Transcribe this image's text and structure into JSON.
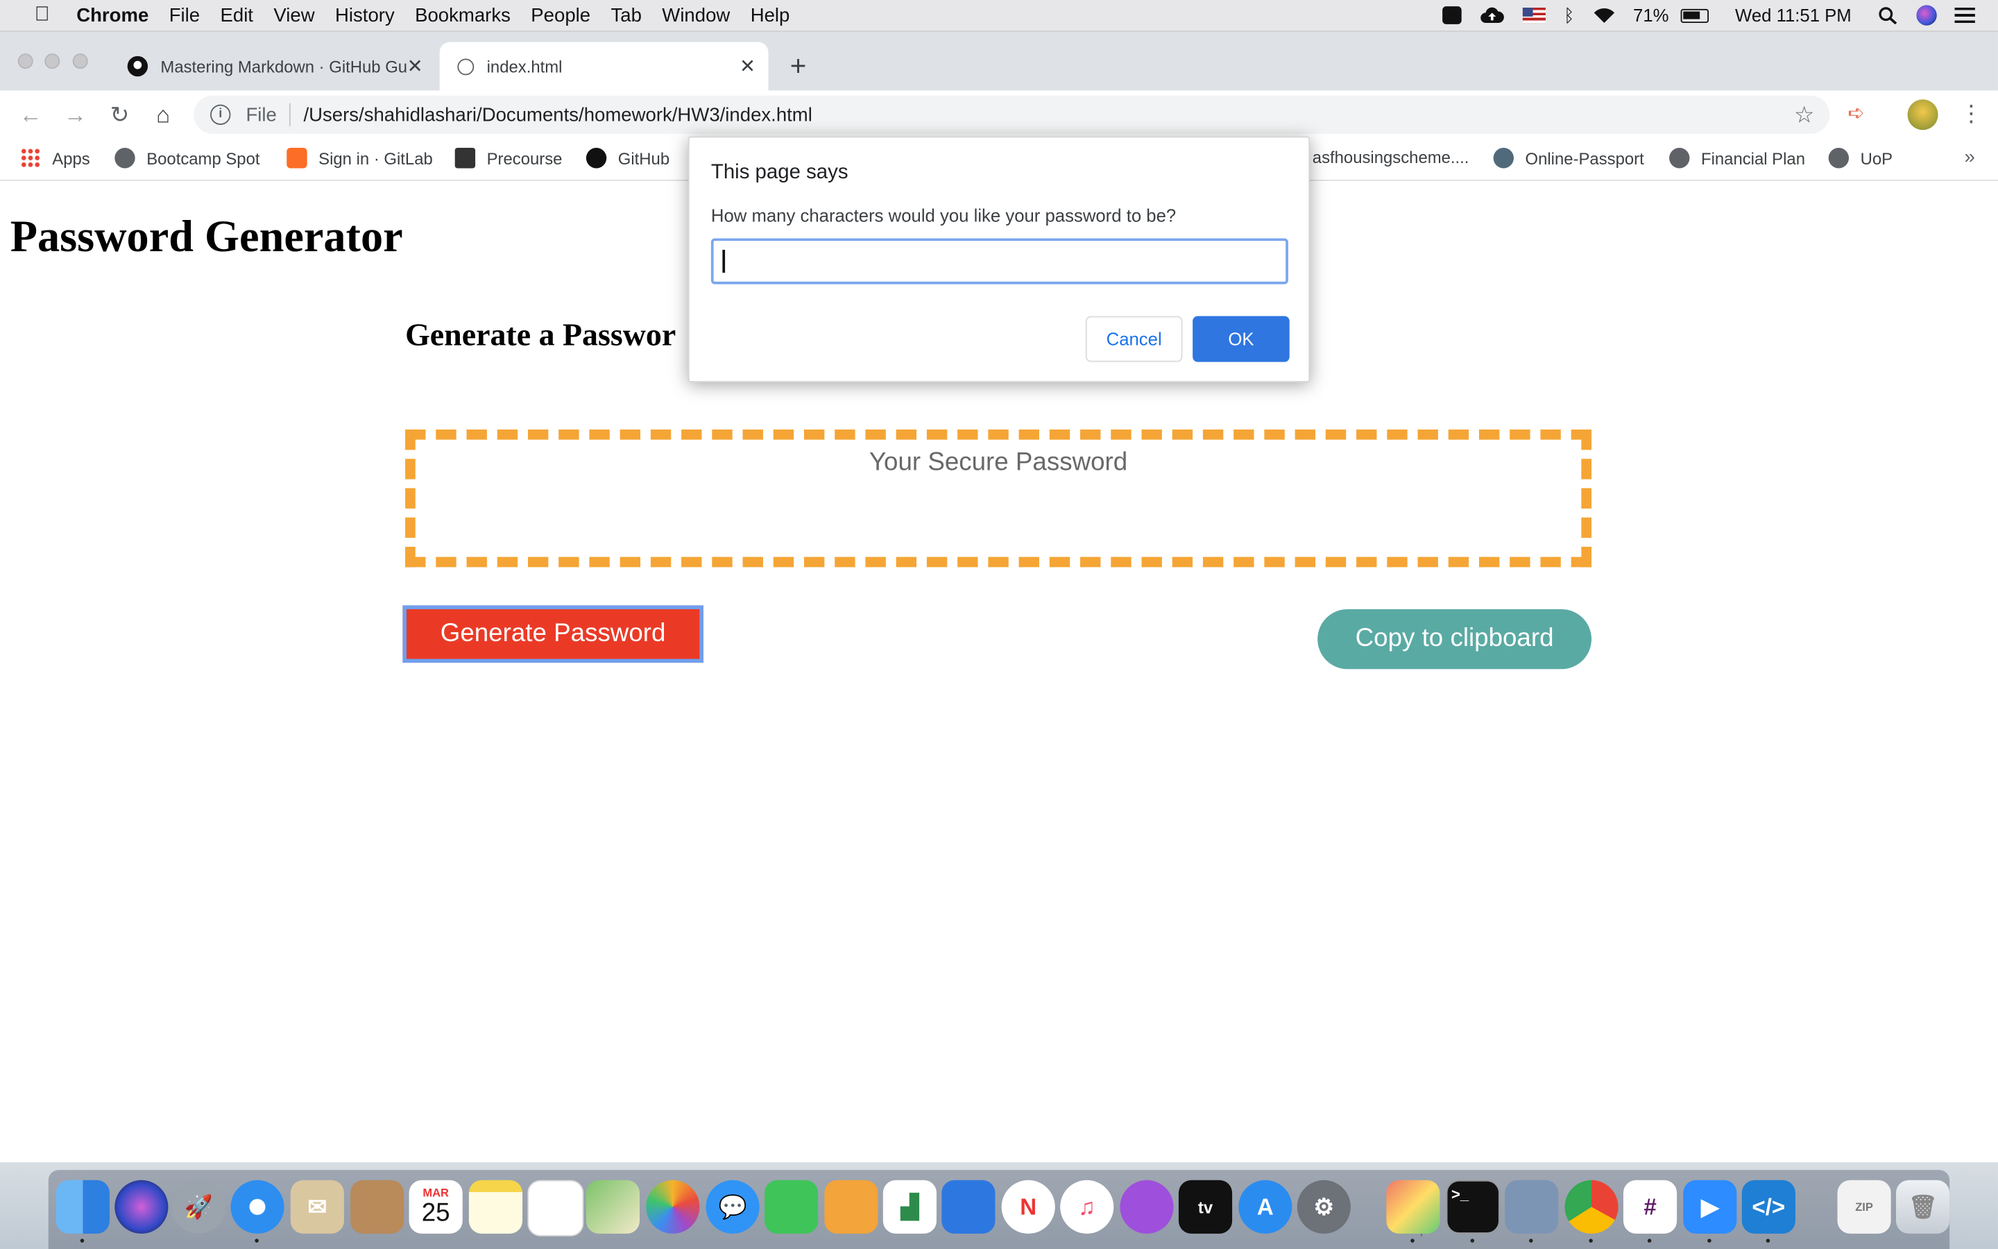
{
  "menubar": {
    "items": [
      "Chrome",
      "File",
      "Edit",
      "View",
      "History",
      "Bookmarks",
      "People",
      "Tab",
      "Window",
      "Help"
    ],
    "battery": "71%",
    "clock": "Wed 11:51 PM"
  },
  "tabs": [
    {
      "title": "Mastering Markdown · GitHub Gu",
      "icon": "github-icon",
      "active": false
    },
    {
      "title": "index.html",
      "icon": "globe-icon",
      "active": true
    }
  ],
  "toolbar": {
    "scheme": "File",
    "url": "/Users/shahidlashari/Documents/homework/HW3/index.html"
  },
  "bookmarks": [
    {
      "label": "Apps",
      "icon": "apps-grid-icon"
    },
    {
      "label": "Bootcamp Spot",
      "icon": "globe-icon"
    },
    {
      "label": "Sign in · GitLab",
      "icon": "gitlab-icon"
    },
    {
      "label": "Precourse",
      "icon": "book-icon"
    },
    {
      "label": "GitHub",
      "icon": "github-icon"
    },
    {
      "label": "asfhousingscheme....",
      "icon": "none"
    },
    {
      "label": "Online-Passport",
      "icon": "passport-icon"
    },
    {
      "label": "Financial Plan",
      "icon": "globe-icon"
    },
    {
      "label": "UoP",
      "icon": "globe-icon"
    }
  ],
  "page": {
    "heading": "Password Generator",
    "card_heading": "Generate a Passwor",
    "password_placeholder": "Your Secure Password",
    "generate_label": "Generate Password",
    "copy_label": "Copy to clipboard"
  },
  "dialog": {
    "title": "This page says",
    "message": "How many characters would you like your password to be?",
    "input_value": "",
    "cancel_label": "Cancel",
    "ok_label": "OK"
  },
  "colors": {
    "generate_button": "#ea3a26",
    "copy_button": "#5aaaa4",
    "password_border": "#f5a535",
    "dialog_ok": "#2f76e1"
  },
  "dock": [
    "Finder",
    "Siri",
    "Launchpad",
    "Safari",
    "Mail",
    "Contacts",
    "Calendar",
    "Notes",
    "Reminders",
    "Maps",
    "Photos",
    "Messages",
    "FaceTime",
    "Pages",
    "Numbers",
    "Keynote",
    "News",
    "Music",
    "Podcasts",
    "TV",
    "App Store",
    "System Preferences",
    "Grapher",
    "Terminal",
    "Preview",
    "Chrome",
    "Slack",
    "Zoom",
    "VS Code",
    "Archive",
    "Trash"
  ],
  "calendar_icon": {
    "month": "MAR",
    "day": "25"
  }
}
